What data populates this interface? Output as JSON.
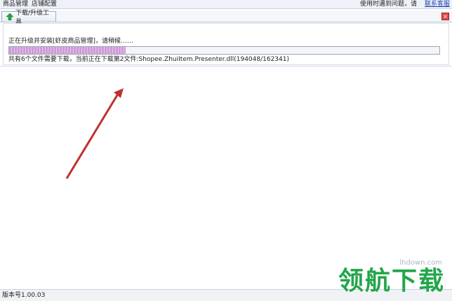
{
  "menubar": {
    "items": [
      "商品管理",
      "店铺配置"
    ],
    "help_text": "使用时遇到问题，请",
    "help_link": "联系客服"
  },
  "tab": {
    "label": "下载/升级工具",
    "close_glyph": "×"
  },
  "install": {
    "status_message": "正在升级并安装[虾皮商品管理]，请稍候……",
    "progress_percent": 27,
    "summary": "共有6个文件需要下载，当前正在下载第2文件:Shopee.ZhuiItem.Presenter.dll(194048/162341)"
  },
  "statusbar": {
    "version": "版本号1.00.03"
  },
  "watermark": {
    "url": "lhdown.com",
    "text": "领航下载"
  },
  "colors": {
    "progress": "#cf9bd9",
    "arrow": "#c03030",
    "watermark": "#22a64a",
    "link": "#1a3fb0"
  },
  "icons": {
    "tab": "green-up-arrow-icon",
    "close": "close-icon"
  }
}
